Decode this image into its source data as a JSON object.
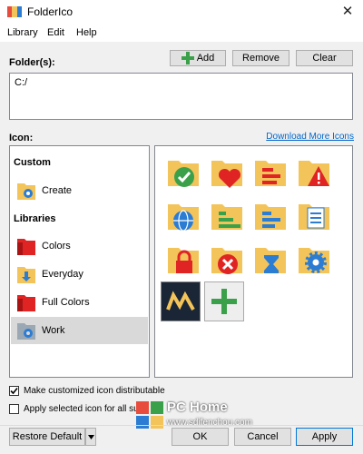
{
  "window": {
    "title": "FolderIco",
    "close_glyph": "✕"
  },
  "menu": [
    "Library",
    "Edit",
    "Help"
  ],
  "folders": {
    "label": "Folder(s):",
    "add_label": "Add",
    "remove_label": "Remove",
    "clear_label": "Clear",
    "value": "C:/"
  },
  "icon_section": {
    "label": "Icon:",
    "download_link": "Download More Icons"
  },
  "library": {
    "custom_header": "Custom",
    "create_label": "Create",
    "libraries_header": "Libraries",
    "items": [
      {
        "label": "Colors",
        "icon": "red-folder-icon"
      },
      {
        "label": "Everyday",
        "icon": "download-folder-icon"
      },
      {
        "label": "Full Colors",
        "icon": "red-folder-icon"
      },
      {
        "label": "Work",
        "icon": "gear-folder-icon",
        "selected": true
      }
    ]
  },
  "icons": [
    "folder-check-icon",
    "folder-heart-icon",
    "folder-bars-icon",
    "folder-warning-icon",
    "folder-globe-icon",
    "folder-bars-green-icon",
    "folder-bars-blue-icon",
    "folder-document-icon",
    "folder-lock-icon",
    "folder-error-icon",
    "folder-hourglass-icon",
    "folder-gear-icon",
    "custom-logo-icon",
    "add-icon"
  ],
  "options": {
    "distributable_label": "Make customized icon distributable",
    "distributable_checked": true,
    "apply_all_label": "Apply selected icon for all subf",
    "apply_all_checked": false
  },
  "footer": {
    "restore_label": "Restore Default",
    "ok_label": "OK",
    "cancel_label": "Cancel",
    "apply_label": "Apply"
  },
  "watermark": {
    "title": "PC Home",
    "url": "www.sdifenchou.com"
  },
  "colors": {
    "folder": "#f3c45a",
    "accent": "#0078d7",
    "green": "#3aa14a",
    "red": "#e02424",
    "blue": "#2b7cd3"
  }
}
